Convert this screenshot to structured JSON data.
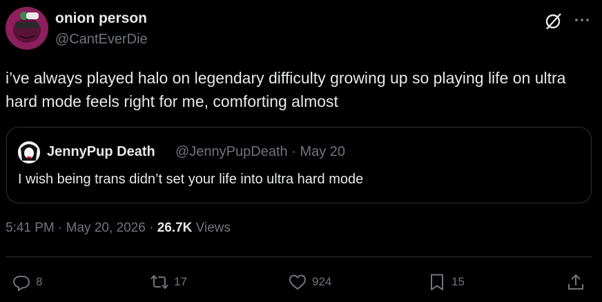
{
  "author": {
    "name": "onion person",
    "handle": "@CantEverDie"
  },
  "tweet": {
    "text": "i’ve always played halo on legendary difficulty growing up so playing life on ultra hard mode feels right for me, comforting almost"
  },
  "quoted": {
    "name": "JennyPup Death",
    "handle": "@JennyPupDeath",
    "sep": "·",
    "date": "May 20",
    "text": "I wish being trans didn’t set your life into ultra hard mode"
  },
  "meta": {
    "time": "5:41 PM",
    "date": "May 20, 2026",
    "views_count": "26.7K",
    "views_label": "Views",
    "sep": "·"
  },
  "actions": {
    "replies": "8",
    "reposts": "17",
    "likes": "924",
    "bookmarks": "15"
  },
  "icons": {
    "top_right": [
      "grok-icon",
      "more-icon"
    ],
    "actions": [
      "reply-icon",
      "repost-icon",
      "like-icon",
      "bookmark-icon",
      "share-icon"
    ]
  },
  "colors": {
    "background": "#000000",
    "text": "#e7e9ea",
    "muted": "#71767b",
    "border": "#2f3336",
    "avatar": "#8c1f5c"
  }
}
